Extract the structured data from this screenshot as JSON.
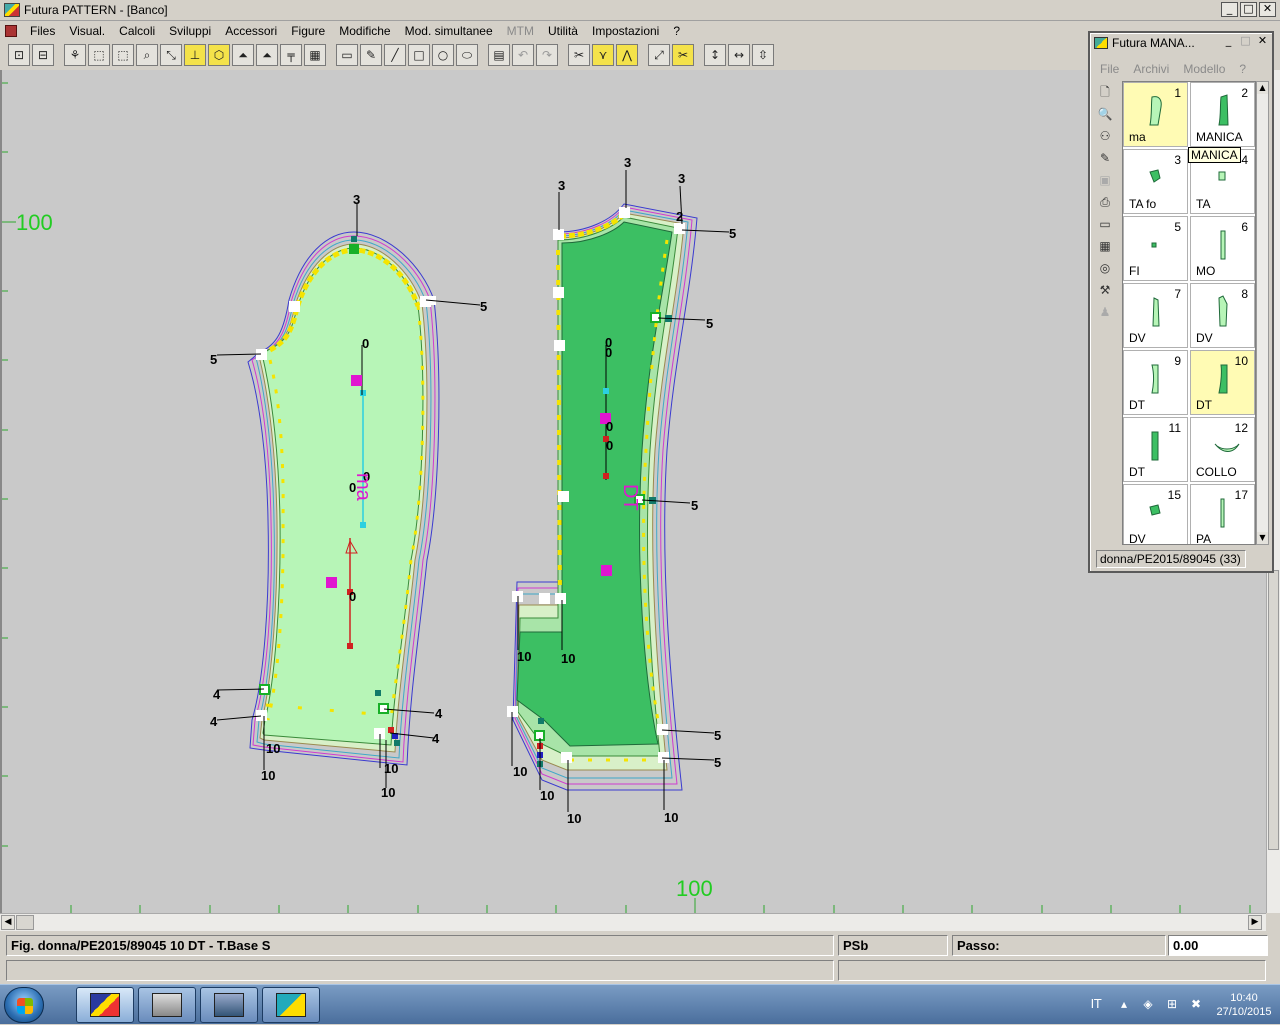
{
  "window": {
    "title": "Futura PATTERN - [Banco]",
    "min": "_",
    "max": "□",
    "close": "✕"
  },
  "menu": [
    {
      "label": "Files",
      "disabled": false
    },
    {
      "label": "Visual.",
      "disabled": false
    },
    {
      "label": "Calcoli",
      "disabled": false
    },
    {
      "label": "Sviluppi",
      "disabled": false
    },
    {
      "label": "Accessori",
      "disabled": false
    },
    {
      "label": "Figure",
      "disabled": false
    },
    {
      "label": "Modifiche",
      "disabled": false
    },
    {
      "label": "Mod. simultanee",
      "disabled": false
    },
    {
      "label": "MTM",
      "disabled": true
    },
    {
      "label": "Utilità",
      "disabled": false
    },
    {
      "label": "Impostazioni",
      "disabled": false
    },
    {
      "label": "?",
      "disabled": false
    }
  ],
  "toolbar": [
    "open-icon",
    "save-icon",
    "|",
    "fan-icon",
    "select-rect-icon",
    "select-dash-icon",
    "zoom-icon",
    "move-point-icon",
    "stamp-icon",
    "shape-icon",
    "layers-icon",
    "layers-red-icon",
    "ruler-icon",
    "grid-icon",
    "|",
    "monitor-icon",
    "pen-icon",
    "line-icon",
    "rect-icon",
    "circle-icon",
    "ellipse-icon",
    "|",
    "page-icon",
    "undo-icon",
    "redo-icon",
    "|",
    "tape-icon",
    "pleat-icon",
    "tuck-icon",
    "|",
    "measure-icon",
    "cut-icon",
    "|",
    "height-icon",
    "width-icon",
    "depth-icon"
  ],
  "canvas": {
    "ruler_left_label": "100",
    "ruler_bottom_label": "100",
    "piece_left_name": "ma",
    "piece_right_name": "DT",
    "labels_left": [
      "3",
      "5",
      "5",
      "0",
      "0",
      "0",
      "0",
      "4",
      "4",
      "4",
      "4",
      "10",
      "10",
      "10",
      "10"
    ],
    "labels_right": [
      "3",
      "3",
      "3",
      "2",
      "5",
      "5",
      "5",
      "0",
      "0",
      "0",
      "0",
      "5",
      "5",
      "10",
      "10",
      "10",
      "10",
      "10",
      "10"
    ]
  },
  "status": {
    "figure": "Fig. donna/PE2015/89045 10 DT - T.Base S",
    "psb": "PSb",
    "passo_label": "Passo:",
    "passo_value": "0.00"
  },
  "subwindow": {
    "title": "Futura MANA...",
    "menu": [
      "File",
      "Archivi",
      "Modello",
      "?"
    ],
    "tooltip": "MANICA",
    "footer": "donna/PE2015/89045 (33)",
    "cells": [
      {
        "num": "1",
        "name": "ma",
        "selected": true
      },
      {
        "num": "2",
        "name": "MANICA",
        "selected": false
      },
      {
        "num": "3",
        "name": "TA  fo",
        "selected": false
      },
      {
        "num": "4",
        "name": "TA",
        "selected": false
      },
      {
        "num": "5",
        "name": "FI",
        "selected": false
      },
      {
        "num": "6",
        "name": "MO",
        "selected": false
      },
      {
        "num": "7",
        "name": "DV",
        "selected": false
      },
      {
        "num": "8",
        "name": "DV",
        "selected": false
      },
      {
        "num": "9",
        "name": "DT",
        "selected": false
      },
      {
        "num": "10",
        "name": "DT",
        "selected": true
      },
      {
        "num": "11",
        "name": "DT",
        "selected": false
      },
      {
        "num": "12",
        "name": "COLLO",
        "selected": false
      },
      {
        "num": "15",
        "name": "DV",
        "selected": false
      },
      {
        "num": "17",
        "name": "PA",
        "selected": false
      }
    ]
  },
  "taskbar": {
    "language": "IT",
    "time": "10:40",
    "date": "27/10/2015"
  },
  "colors": {
    "canvas_bg": "#c9c9c9",
    "piece_light": "#b7f5b7",
    "piece_dark": "#3cbf63",
    "seam_yellow": "#f5e400",
    "marker_magenta": "#e016d0",
    "ruler_green": "#22cc22"
  }
}
